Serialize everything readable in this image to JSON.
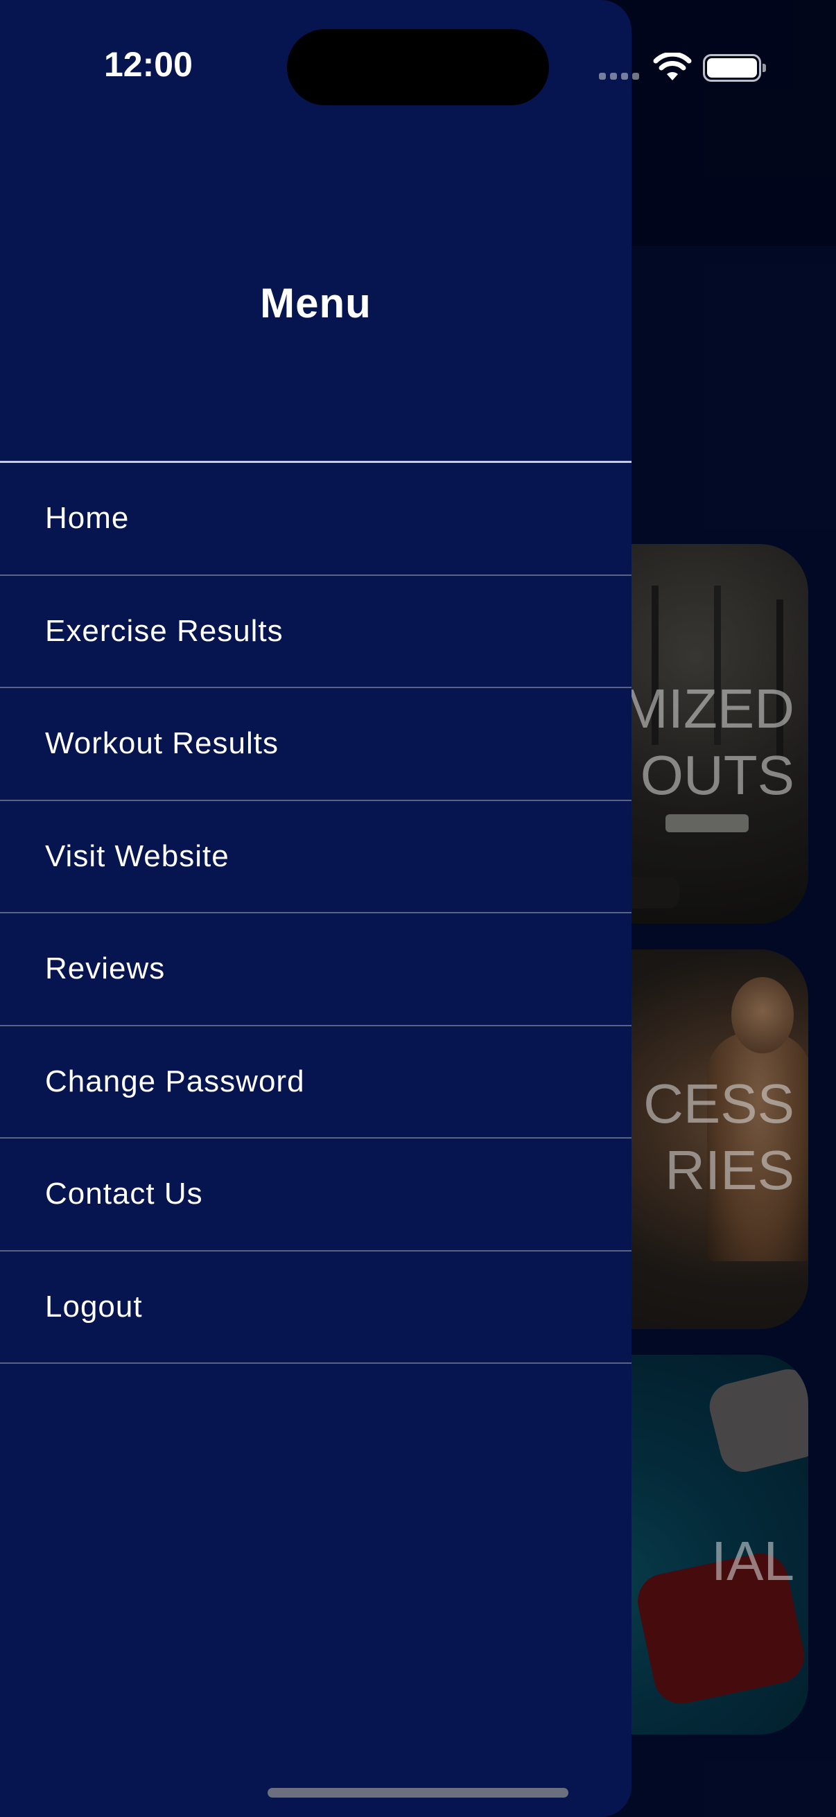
{
  "status_bar": {
    "time": "12:00"
  },
  "drawer": {
    "title": "Menu",
    "items": [
      {
        "label": "Home"
      },
      {
        "label": "Exercise Results"
      },
      {
        "label": "Workout Results"
      },
      {
        "label": "Visit Website"
      },
      {
        "label": "Reviews"
      },
      {
        "label": "Change Password"
      },
      {
        "label": "Contact Us"
      },
      {
        "label": "Logout"
      }
    ]
  },
  "background_cards": {
    "card1": {
      "line1": "MIZED",
      "line2": "OUTS"
    },
    "card2": {
      "line1": "CESS",
      "line2": "RIES"
    },
    "card3": {
      "line1": "IAL"
    }
  },
  "colors": {
    "drawer_bg": "#06154f",
    "app_bg": "#040f3a",
    "divider": "#5a6482",
    "text": "#ffffff"
  }
}
